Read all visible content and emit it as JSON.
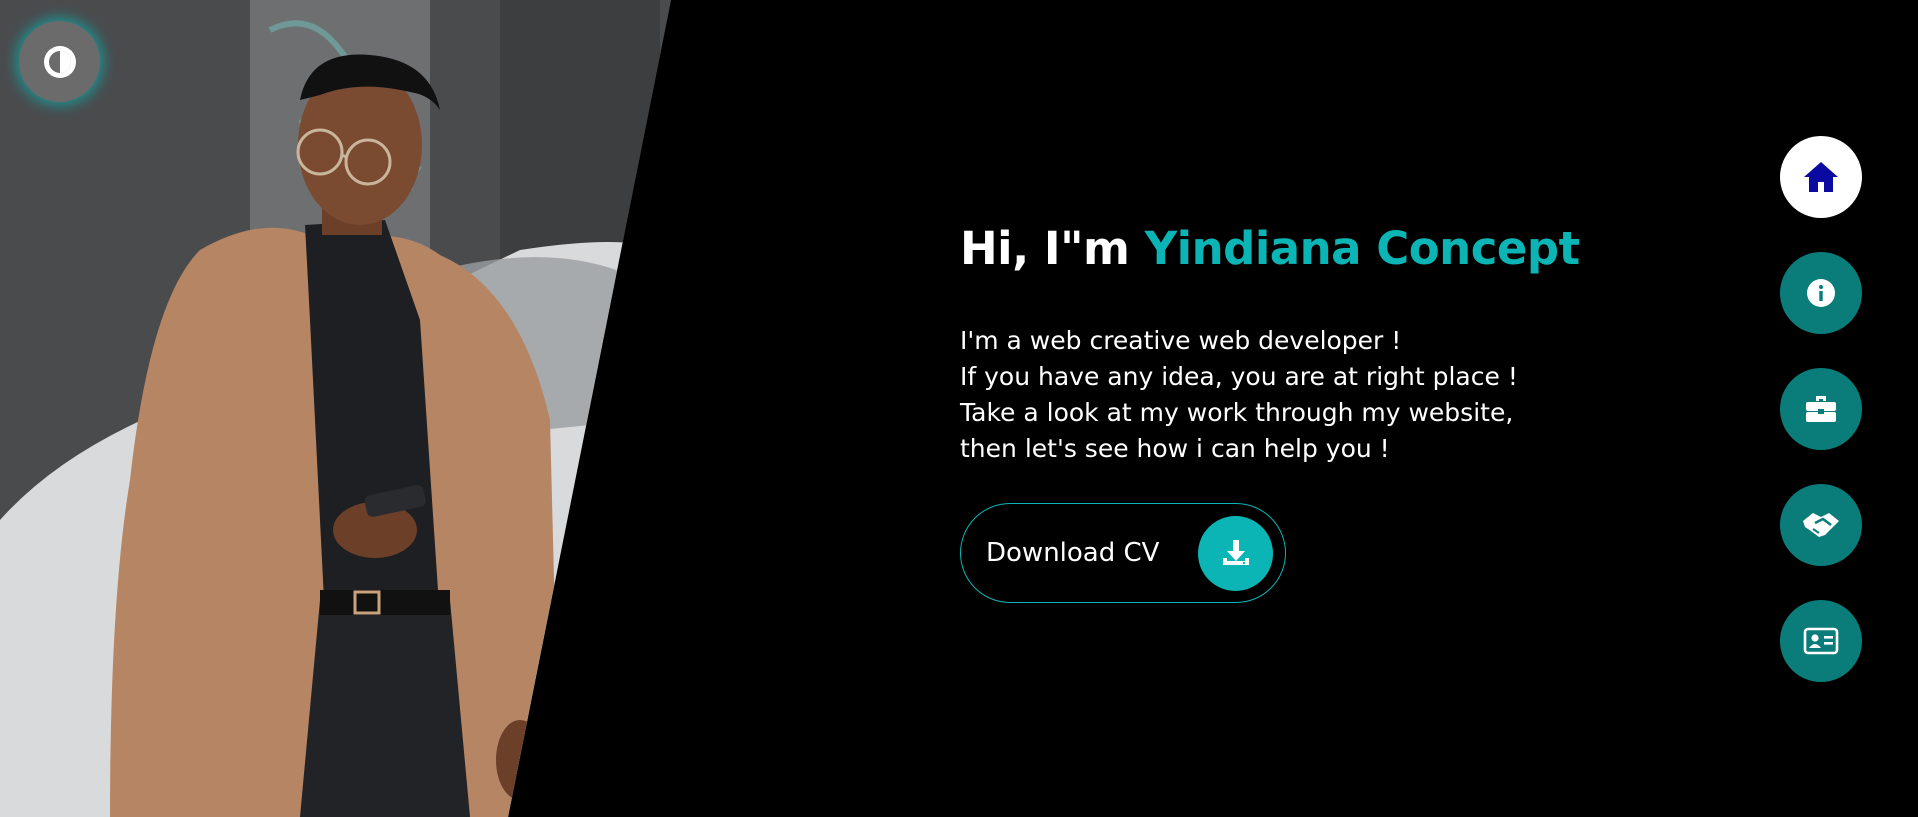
{
  "theme_toggle": {
    "icon": "half-circle-contrast-icon"
  },
  "photo": {
    "subject": "portrait-photo",
    "alt": ""
  },
  "hero": {
    "greeting": "Hi, I\"m ",
    "name": "Yindiana Concept",
    "description_lines": [
      "I'm a web creative web developer !",
      "If you have any idea, you are at right place !",
      "Take a look at my work through my website,",
      "then let's see how i can help you !"
    ],
    "cv_button": {
      "label": "Download CV",
      "icon": "download-icon"
    }
  },
  "nav": {
    "items": [
      {
        "id": "home",
        "icon": "home-icon",
        "active": true
      },
      {
        "id": "about",
        "icon": "info-icon",
        "active": false
      },
      {
        "id": "portfolio",
        "icon": "briefcase-icon",
        "active": false
      },
      {
        "id": "services",
        "icon": "handshake-icon",
        "active": false
      },
      {
        "id": "contact",
        "icon": "contact-card-icon",
        "active": false
      }
    ]
  },
  "colors": {
    "background": "#000000",
    "accent": "#0bb5b5",
    "nav_button": "#0a7d7b",
    "nav_active": "#ffffff",
    "home_icon": "#0a0aa0",
    "toggle": "#6b6b6b"
  }
}
